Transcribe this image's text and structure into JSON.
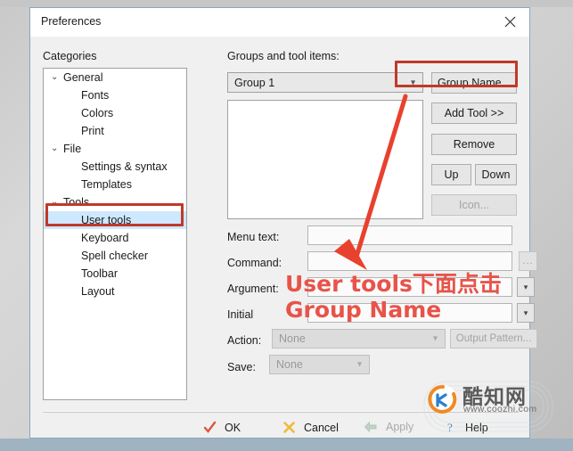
{
  "window": {
    "title": "Preferences",
    "close_icon": "close-icon"
  },
  "left_panel": {
    "label": "Categories",
    "tree": [
      {
        "label": "General",
        "level": 0,
        "expanded": true,
        "selected": false
      },
      {
        "label": "Fonts",
        "level": 1,
        "expanded": false,
        "selected": false
      },
      {
        "label": "Colors",
        "level": 1,
        "expanded": false,
        "selected": false
      },
      {
        "label": "Print",
        "level": 1,
        "expanded": false,
        "selected": false
      },
      {
        "label": "File",
        "level": 0,
        "expanded": true,
        "selected": false
      },
      {
        "label": "Settings & syntax",
        "level": 1,
        "expanded": false,
        "selected": false
      },
      {
        "label": "Templates",
        "level": 1,
        "expanded": false,
        "selected": false
      },
      {
        "label": "Tools",
        "level": 0,
        "expanded": true,
        "selected": false
      },
      {
        "label": "User tools",
        "level": 1,
        "expanded": false,
        "selected": true
      },
      {
        "label": "Keyboard",
        "level": 1,
        "expanded": false,
        "selected": false
      },
      {
        "label": "Spell checker",
        "level": 1,
        "expanded": false,
        "selected": false
      },
      {
        "label": "Toolbar",
        "level": 1,
        "expanded": false,
        "selected": false
      },
      {
        "label": "Layout",
        "level": 1,
        "expanded": false,
        "selected": false
      }
    ]
  },
  "right_panel": {
    "label": "Groups and tool items:",
    "group_combo": {
      "value": "Group 1",
      "chevron": "chevron-down-icon"
    },
    "tool_list_items": [],
    "buttons": {
      "group_name": "Group Name...",
      "add_tool": "Add Tool >>",
      "remove": "Remove",
      "up": "Up",
      "down": "Down",
      "icon": "Icon...",
      "icon_disabled": true,
      "browse": "...",
      "output_pattern": "Output Pattern...",
      "output_pattern_disabled": true
    },
    "form": {
      "menu_text": {
        "label": "Menu text:",
        "value": ""
      },
      "command": {
        "label": "Command:",
        "value": ""
      },
      "argument": {
        "label": "Argument:",
        "value": "",
        "dropdown": "chevron-down-icon"
      },
      "initial": {
        "label": "Initial",
        "value": "",
        "dropdown": "chevron-down-icon"
      },
      "action": {
        "label": "Action:",
        "value": "None",
        "disabled": true
      },
      "save": {
        "label": "Save:",
        "value": "None",
        "disabled": true
      }
    }
  },
  "footer": {
    "ok": {
      "label": "OK",
      "icon": "check-icon"
    },
    "cancel": {
      "label": "Cancel",
      "icon": "cross-icon"
    },
    "apply": {
      "label": "Apply",
      "icon": "arrow-left-icon",
      "disabled": true
    },
    "help": {
      "label": "Help",
      "icon": "help-icon"
    }
  },
  "annotations": {
    "text_line1": "User tools下面点击",
    "text_line2": "Group Name",
    "color": "#e8534a",
    "box_color": "#c0392b",
    "highlight_user_tools": "User tools",
    "highlight_group_name": "Group Name...",
    "arrow": "red-arrow-pointer"
  },
  "watermark": {
    "brand_cn": "酷知网",
    "url": "www.coozhi.com"
  }
}
